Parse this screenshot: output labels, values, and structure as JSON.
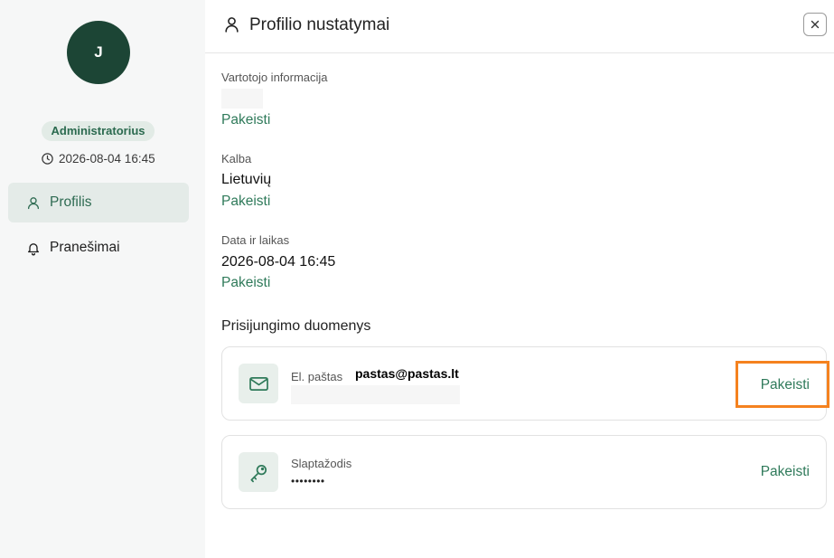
{
  "sidebar": {
    "avatar_initial": "J",
    "role_badge": "Administratorius",
    "datetime": "2026-08-04 16:45",
    "datetime_icon": "clock-icon",
    "nav": [
      {
        "label": "Profilis",
        "icon": "user-icon",
        "active": true
      },
      {
        "label": "Pranešimai",
        "icon": "bell-icon",
        "active": false
      }
    ]
  },
  "header": {
    "title": "Profilio nustatymai",
    "icon": "user-icon",
    "close_icon": "close-icon"
  },
  "sections": {
    "user_info": {
      "label": "Vartotojo informacija",
      "action": "Pakeisti"
    },
    "language": {
      "label": "Kalba",
      "value": "Lietuvių",
      "action": "Pakeisti"
    },
    "datetime": {
      "label": "Data ir laikas",
      "value": "2026-08-04 16:45",
      "action": "Pakeisti"
    }
  },
  "login": {
    "heading": "Prisijungimo duomenys",
    "email": {
      "label": "El. paštas",
      "value": "pastas@pastas.lt",
      "action": "Pakeisti",
      "icon": "mail-icon"
    },
    "password": {
      "label": "Slaptažodis",
      "value": "••••••••",
      "action": "Pakeisti",
      "icon": "key-icon"
    }
  },
  "colors": {
    "accent": "#2f7a5a",
    "avatar": "#1c4535",
    "badge_bg": "#e2ebe6",
    "active_nav_bg": "#e4ebe8",
    "sidebar_bg": "#f6f7f7",
    "highlight": "#f5821f"
  }
}
